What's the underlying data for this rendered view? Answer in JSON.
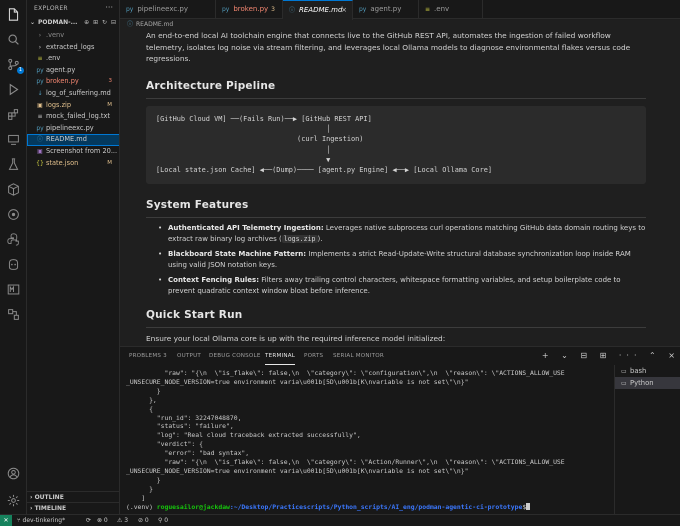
{
  "sidebar": {
    "title": "EXPLORER",
    "more": "···",
    "project": "PODMAN-...",
    "tools": "⊕ ⊞ ↻ ⊟",
    "items": [
      {
        "name": ".venv",
        "icon": "›",
        "status": ""
      },
      {
        "name": "extracted_logs",
        "icon": "›",
        "status": ""
      },
      {
        "name": ".env",
        "icon": "≡",
        "status": ""
      },
      {
        "name": "agent.py",
        "icon": "py",
        "status": ""
      },
      {
        "name": "broken.py",
        "icon": "py",
        "status": "3"
      },
      {
        "name": "log_of_suffering.md",
        "icon": "↓",
        "status": ""
      },
      {
        "name": "logs.zip",
        "icon": "▣",
        "status": "M"
      },
      {
        "name": "mock_failed_log.txt",
        "icon": "≡",
        "status": ""
      },
      {
        "name": "pipelineexc.py",
        "icon": "py",
        "status": ""
      },
      {
        "name": "README.md",
        "icon": "ⓘ",
        "status": ""
      },
      {
        "name": "Screenshot from 20...",
        "icon": "▣",
        "status": ""
      },
      {
        "name": "state.json",
        "icon": "{}",
        "status": "M"
      }
    ],
    "outline": "OUTLINE",
    "timeline": "TIMELINE"
  },
  "tabs": [
    {
      "label": "pipelineexc.py",
      "icon": "py",
      "mark": ""
    },
    {
      "label": "broken.py",
      "icon": "py",
      "mark": "3"
    },
    {
      "label": "README.md",
      "icon": "ⓘ",
      "mark": ""
    },
    {
      "label": "agent.py",
      "icon": "py",
      "mark": ""
    },
    {
      "label": ".env",
      "icon": "≡",
      "mark": ""
    }
  ],
  "tab_close": "×",
  "breadcrumb": {
    "icon": "ⓘ",
    "label": "README.md"
  },
  "readme": {
    "intro": "An end-to-end local AI toolchain engine that connects live to the GitHub REST API, automates the ingestion of failed workflow telemetry, isolates log noise via stream filtering, and leverages local Ollama models to diagnose environmental flakes versus code regressions.",
    "h_arch": "Architecture Pipeline",
    "diagram": "[GitHub Cloud VM] ──(Fails Run)──▶ [GitHub REST API]\n                                         │\n                                  (curl Ingestion)\n                                         │\n                                         ▼\n[Local state.json Cache] ◀──(Dump)──── [agent.py Engine] ◀──▶ [Local Ollama Core]",
    "h_features": "System Features",
    "features": [
      {
        "title": "Authenticated API Telemetry Ingestion:",
        "text": " Leverages native subprocess curl operations matching GitHub data domain routing keys to extract raw binary log archives (",
        "code": "logs.zip",
        "tail": ")."
      },
      {
        "title": "Blackboard State Machine Pattern:",
        "text": " Implements a strict Read-Update-Write structural database synchronization loop inside RAM using valid JSON notation keys.",
        "code": "",
        "tail": ""
      },
      {
        "title": "Context Fencing Rules:",
        "text": " Filters away trailing control characters, whitespace formatting variables, and setup boilerplate code to prevent quadratic context window bloat before inference.",
        "code": "",
        "tail": ""
      }
    ],
    "h_quick": "Quick Start Run",
    "quick": "Ensure your local Ollama core is up with the required inference model initialized:"
  },
  "panel": {
    "tabs": [
      "PROBLEMS",
      "OUTPUT",
      "DEBUG CONSOLE",
      "TERMINAL",
      "PORTS",
      "SERIAL MONITOR"
    ],
    "problems_badge": "3",
    "tools": "+ ⌄ ⊟ ⊞ ··· ⌃ ×",
    "terminal_lines": [
      "          \"raw\": \"{\\n  \\\"is_flake\\\": false,\\n  \\\"category\\\": \\\"configuration\\\",\\n  \\\"reason\\\": \\\"ACTIONS_ALLOW_USE",
      "_UNSECURE_NODE_VERSION=true environment varia\\u001b[5D\\u001b[K\\nvariable is not set\\\"\\n}\"",
      "        }",
      "      },",
      "      {",
      "        \"run_id\": 32247048870,",
      "        \"status\": \"failure\",",
      "        \"log\": \"Real cloud traceback extracted successfully\",",
      "        \"verdict\": {",
      "          \"error\": \"bad syntax\",",
      "          \"raw\": \"{\\n  \\\"is_flake\\\": false,\\n  \\\"category\\\": \\\"Action/Runner\\\",\\n  \\\"reason\\\": \\\"ACTIONS_ALLOW_USE",
      "_UNSECURE_NODE_VERSION=true environment varia\\u001b[5D\\u001b[K\\nvariable is not set\\\"\\n}\"",
      "        }",
      "      }",
      "    ]"
    ],
    "prompt_prefix": "(.venv) ",
    "prompt_user": "roguesailor@jackdaw",
    "prompt_path": ":~/Desktop/Practicescripts/Python_scripts/AI_eng/podman-agentic-ci-prototype",
    "prompt_symbol": "$",
    "terminals": [
      {
        "icon": "▭",
        "label": "bash"
      },
      {
        "icon": "▭",
        "label": "Python"
      }
    ]
  },
  "statusbar": {
    "remote": "✕",
    "branch": "dev-tinkering*",
    "sync": "⟳",
    "errors": "⊗ 0",
    "warnings": "⚠ 3",
    "info": "⊘ 0",
    "ports": "⚲ 0"
  },
  "activity_badge": "1"
}
